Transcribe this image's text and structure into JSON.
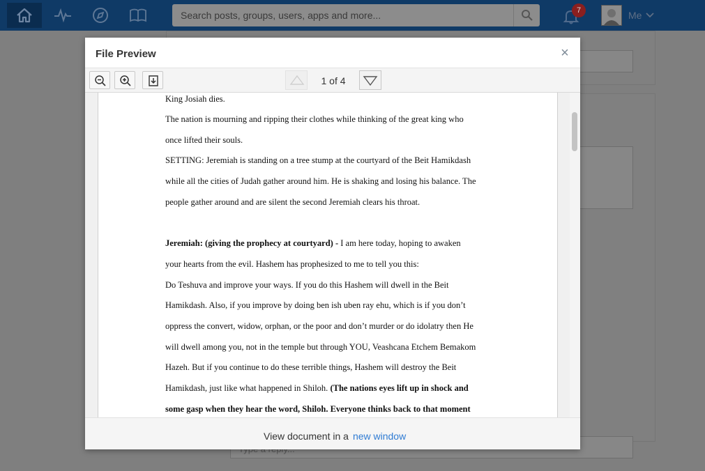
{
  "nav": {
    "search_placeholder": "Search posts, groups, users, apps and more...",
    "notification_count": "7",
    "me_label": "Me"
  },
  "background": {
    "reply_placeholder": "Type a reply..."
  },
  "modal": {
    "title": "File Preview",
    "close_glyph": "×",
    "page_indicator": "1 of 4",
    "footer_text": "View document in a",
    "footer_link": "new window",
    "document_lines": [
      {
        "parts": [
          {
            "text": "King Josiah dies.",
            "bold": false
          }
        ]
      },
      {
        "parts": [
          {
            "text": "The nation is mourning and ripping their clothes while thinking of the great king who",
            "bold": false
          }
        ]
      },
      {
        "parts": [
          {
            "text": "once lifted their souls.",
            "bold": false
          }
        ]
      },
      {
        "parts": [
          {
            "text": "SETTING: Jeremiah is standing on a tree stump at the courtyard of the Beit Hamikdash",
            "bold": false
          }
        ]
      },
      {
        "parts": [
          {
            "text": "while all the cities of Judah gather around him. He is shaking and losing his balance. The",
            "bold": false
          }
        ]
      },
      {
        "parts": [
          {
            "text": "people gather around and are silent the second Jeremiah clears his throat.",
            "bold": false
          }
        ]
      },
      {
        "parts": [
          {
            "text": "Jeremiah: (giving the prophecy at courtyard) -",
            "bold": true
          },
          {
            "text": " I am here today, hoping to awaken",
            "bold": false
          }
        ]
      },
      {
        "parts": [
          {
            "text": "your hearts from the evil. Hashem has prophesized to me to tell you this:",
            "bold": false
          }
        ]
      },
      {
        "parts": [
          {
            "text": "Do Teshuva and improve your ways. If you do this Hashem will dwell in the Beit",
            "bold": false
          }
        ]
      },
      {
        "parts": [
          {
            "text": "Hamikdash. Also, if you improve by doing ben ish uben ray ehu, which is if you don’t",
            "bold": false
          }
        ]
      },
      {
        "parts": [
          {
            "text": "oppress the convert, widow, orphan, or the poor and don’t murder or do idolatry then He",
            "bold": false
          }
        ]
      },
      {
        "parts": [
          {
            "text": "will dwell among you, not in the temple but through YOU, Veashcana Etchem Bemakom",
            "bold": false
          }
        ]
      },
      {
        "parts": [
          {
            "text": "Hazeh. But if you continue to do these terrible things, Hashem will destroy the Beit",
            "bold": false
          }
        ]
      },
      {
        "parts": [
          {
            "text": "Hamikdash, just like what happened in Shiloh. ",
            "bold": false
          },
          {
            "text": "(The nations eyes lift up in shock and",
            "bold": true
          }
        ]
      },
      {
        "parts": [
          {
            "text": "some gasp when they hear the word, Shiloh. Everyone thinks back to that moment",
            "bold": true
          }
        ]
      }
    ]
  },
  "colors": {
    "nav_bar": "#0f3a66",
    "overlay_bg": "#7f7f7f",
    "link": "#2f7bd3",
    "badge": "#8a1f1f"
  }
}
